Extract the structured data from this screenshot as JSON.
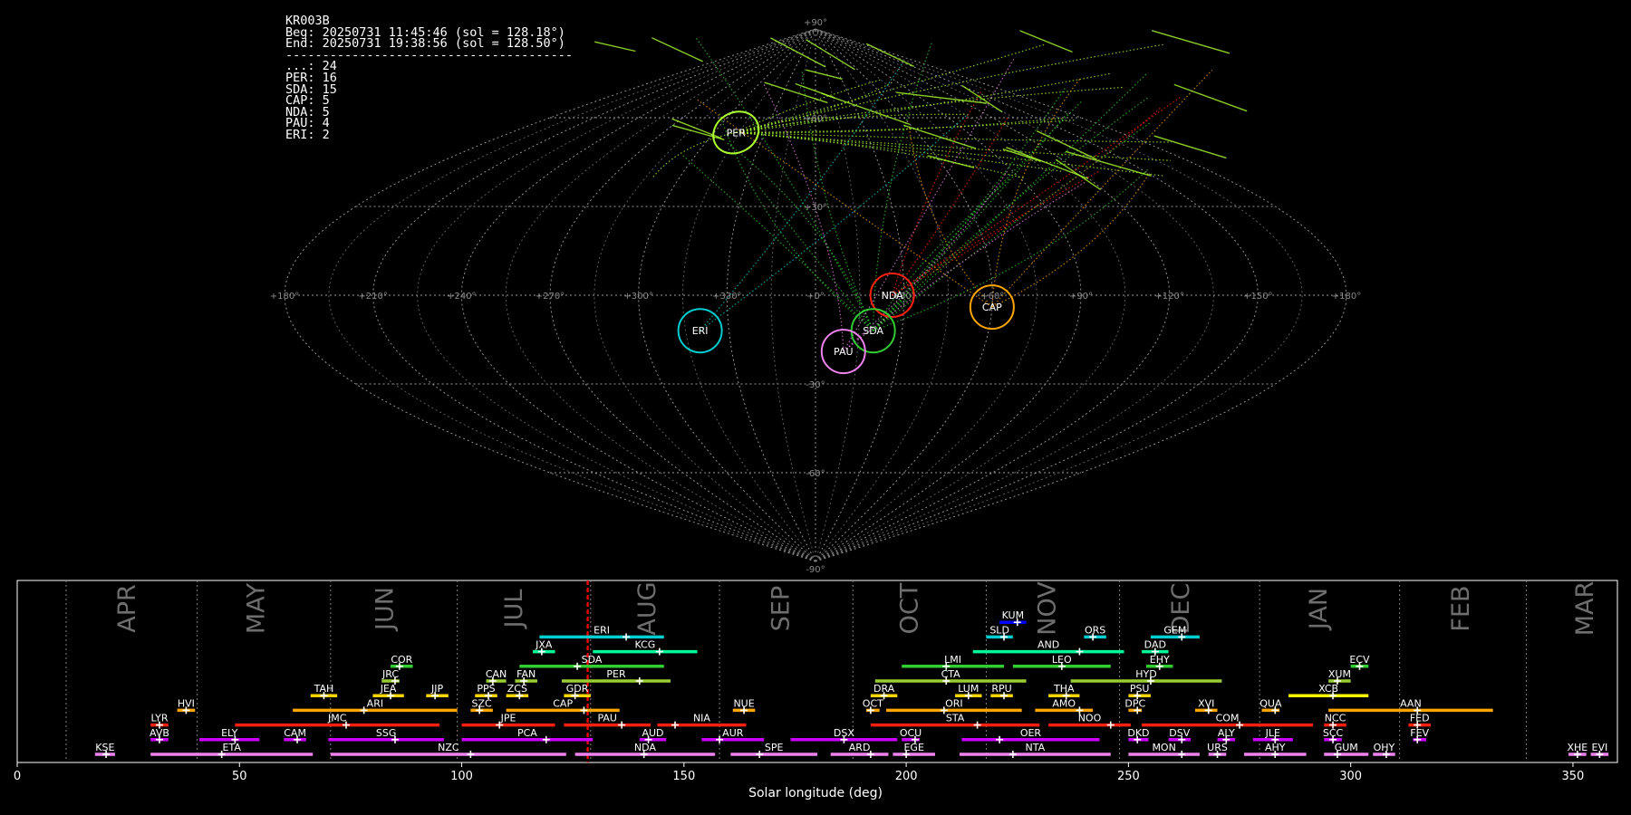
{
  "info": {
    "lines": [
      "KR003B",
      "Beg: 20250731 11:45:46 (sol = 128.18°)",
      "End: 20250731 19:38:56 (sol = 128.50°)",
      "---------------------------------------",
      "...: 24",
      "PER: 16",
      "SDA: 15",
      "CAP: 5",
      "NDA: 5",
      "PAU: 4",
      "ERI: 2"
    ]
  },
  "sky_map": {
    "lon_labels": [
      "+180°",
      "+150°",
      "+120°",
      "+90°",
      "+60°",
      "+30°",
      "+0°",
      "+330°",
      "+300°",
      "+270°",
      "+240°",
      "+210°",
      "+180°"
    ],
    "lat_labels": [
      "+90°",
      "+60°",
      "+30°",
      "-30°",
      "-60°",
      "-90°"
    ],
    "radiants": [
      {
        "code": "PER",
        "lon": 47,
        "lat": 55,
        "color": "#adff2f"
      },
      {
        "code": "NDA",
        "lon": 334,
        "lat": 0,
        "color": "#ff2010"
      },
      {
        "code": "CAP",
        "lon": 300,
        "lat": -4,
        "color": "#ffa500"
      },
      {
        "code": "SDA",
        "lon": 340,
        "lat": -12,
        "color": "#32cd32"
      },
      {
        "code": "PAU",
        "lon": 350,
        "lat": -19,
        "color": "#ee82ee"
      },
      {
        "code": "ERI",
        "lon": 40,
        "lat": -12,
        "color": "#00ced1"
      }
    ]
  },
  "chart_data": {
    "type": "timeline",
    "xlabel": "Solar longitude (deg)",
    "xlim": [
      0,
      360
    ],
    "xticks": [
      0,
      50,
      100,
      150,
      200,
      250,
      300,
      350
    ],
    "current_sol_range": [
      128.18,
      128.5
    ],
    "months": [
      {
        "name": "APR",
        "start": 11,
        "label_at": 25
      },
      {
        "name": "MAY",
        "start": 40.5,
        "label_at": 54
      },
      {
        "name": "JUN",
        "start": 70.5,
        "label_at": 83
      },
      {
        "name": "JUL",
        "start": 99,
        "label_at": 112
      },
      {
        "name": "AUG",
        "start": 129,
        "label_at": 142
      },
      {
        "name": "SEP",
        "start": 158,
        "label_at": 172
      },
      {
        "name": "OCT",
        "start": 188,
        "label_at": 201
      },
      {
        "name": "NOV",
        "start": 218,
        "label_at": 232
      },
      {
        "name": "DEC",
        "start": 248,
        "label_at": 262
      },
      {
        "name": "JAN",
        "start": 279.5,
        "label_at": 293
      },
      {
        "name": "FEB",
        "start": 311,
        "label_at": 325
      },
      {
        "name": "MAR",
        "start": 339.5,
        "label_at": 353
      }
    ],
    "showers": [
      {
        "code": "KUM",
        "start": 221,
        "end": 227,
        "peak": 225,
        "row": 10,
        "color": "#0000ff"
      },
      {
        "code": "ERI",
        "start": 117.5,
        "end": 145.5,
        "peak": 137,
        "row": 9,
        "color": "#00ced1"
      },
      {
        "code": "SLD",
        "start": 218,
        "end": 224,
        "peak": 222,
        "row": 9,
        "color": "#00ced1"
      },
      {
        "code": "ORS",
        "start": 240,
        "end": 245,
        "peak": 242,
        "row": 9,
        "color": "#00ced1"
      },
      {
        "code": "GEM",
        "start": 255,
        "end": 266,
        "peak": 262,
        "row": 9,
        "color": "#00ced1"
      },
      {
        "code": "JXA",
        "start": 116,
        "end": 121,
        "peak": 118,
        "row": 8,
        "color": "#00fa9a"
      },
      {
        "code": "KCG",
        "start": 129.5,
        "end": 153,
        "peak": 144.5,
        "row": 8,
        "color": "#00fa9a"
      },
      {
        "code": "AND",
        "start": 215,
        "end": 249,
        "peak": 239,
        "row": 8,
        "color": "#00fa9a"
      },
      {
        "code": "DAD",
        "start": 253,
        "end": 259,
        "peak": 256,
        "row": 8,
        "color": "#00fa9a"
      },
      {
        "code": "COR",
        "start": 84,
        "end": 89,
        "peak": 86,
        "row": 7,
        "color": "#32cd32"
      },
      {
        "code": "SDA",
        "start": 113,
        "end": 145.5,
        "peak": 126,
        "row": 7,
        "color": "#32cd32"
      },
      {
        "code": "LMI",
        "start": 199,
        "end": 222,
        "peak": 209,
        "row": 7,
        "color": "#32cd32"
      },
      {
        "code": "LEO",
        "start": 224,
        "end": 246,
        "peak": 235,
        "row": 7,
        "color": "#32cd32"
      },
      {
        "code": "EHY",
        "start": 254,
        "end": 260,
        "peak": 257,
        "row": 7,
        "color": "#32cd32"
      },
      {
        "code": "ECV",
        "start": 300,
        "end": 304,
        "peak": 302,
        "row": 7,
        "color": "#32cd32"
      },
      {
        "code": "JRC",
        "start": 82,
        "end": 86,
        "peak": 85,
        "row": 6,
        "color": "#9acd32"
      },
      {
        "code": "CAN",
        "start": 105.5,
        "end": 110,
        "peak": 107,
        "row": 6,
        "color": "#9acd32"
      },
      {
        "code": "FAN",
        "start": 112,
        "end": 117,
        "peak": 114,
        "row": 6,
        "color": "#9acd32"
      },
      {
        "code": "PER",
        "start": 122.5,
        "end": 147,
        "peak": 140,
        "row": 6,
        "color": "#9acd32"
      },
      {
        "code": "CTA",
        "start": 193,
        "end": 227,
        "peak": 209,
        "row": 6,
        "color": "#9acd32"
      },
      {
        "code": "HYD",
        "start": 237,
        "end": 271,
        "peak": 255,
        "row": 6,
        "color": "#9acd32"
      },
      {
        "code": "XUM",
        "start": 295,
        "end": 300,
        "peak": 297,
        "row": 6,
        "color": "#9acd32"
      },
      {
        "code": "TAH",
        "start": 66,
        "end": 72,
        "peak": 69,
        "row": 5,
        "color": "#ffd700"
      },
      {
        "code": "JEA",
        "start": 80,
        "end": 87,
        "peak": 84,
        "row": 5,
        "color": "#ffd700"
      },
      {
        "code": "JIP",
        "start": 92,
        "end": 97,
        "peak": 94,
        "row": 5,
        "color": "#ffd700"
      },
      {
        "code": "PPS",
        "start": 103,
        "end": 108,
        "peak": 106,
        "row": 5,
        "color": "#ffd700"
      },
      {
        "code": "ZCS",
        "start": 110,
        "end": 115,
        "peak": 113,
        "row": 5,
        "color": "#ffd700"
      },
      {
        "code": "GDR",
        "start": 123,
        "end": 129,
        "peak": 125.5,
        "row": 5,
        "color": "#ffd700"
      },
      {
        "code": "DRA",
        "start": 192,
        "end": 198,
        "peak": 195,
        "row": 5,
        "color": "#ffd700"
      },
      {
        "code": "LUM",
        "start": 211,
        "end": 217,
        "peak": 214,
        "row": 5,
        "color": "#ffd700"
      },
      {
        "code": "RPU",
        "start": 219,
        "end": 224,
        "peak": 222,
        "row": 5,
        "color": "#ffd700"
      },
      {
        "code": "THA",
        "start": 232,
        "end": 239,
        "peak": 236,
        "row": 5,
        "color": "#ffd700"
      },
      {
        "code": "PSU",
        "start": 250,
        "end": 255,
        "peak": 252,
        "row": 5,
        "color": "#ffd700"
      },
      {
        "code": "XCB",
        "start": 286,
        "end": 304,
        "peak": 296,
        "row": 5,
        "color": "#ffff00"
      },
      {
        "code": "HVI",
        "start": 36,
        "end": 40,
        "peak": 38,
        "row": 4,
        "color": "#ffa500"
      },
      {
        "code": "ARI",
        "start": 62,
        "end": 99,
        "peak": 78,
        "row": 4,
        "color": "#ffa500"
      },
      {
        "code": "SZC",
        "start": 102,
        "end": 107,
        "peak": 104,
        "row": 4,
        "color": "#ffa500"
      },
      {
        "code": "CAP",
        "start": 110,
        "end": 135.5,
        "peak": 127.5,
        "row": 4,
        "color": "#ffa500"
      },
      {
        "code": "NUE",
        "start": 161,
        "end": 166,
        "peak": 163.5,
        "row": 4,
        "color": "#ffa500"
      },
      {
        "code": "OCT",
        "start": 191,
        "end": 194,
        "peak": 192,
        "row": 4,
        "color": "#ffa500"
      },
      {
        "code": "ORI",
        "start": 195.5,
        "end": 226,
        "peak": 208.5,
        "row": 4,
        "color": "#ffa500"
      },
      {
        "code": "AMO",
        "start": 229,
        "end": 242,
        "peak": 239,
        "row": 4,
        "color": "#ffa500"
      },
      {
        "code": "DPC",
        "start": 250,
        "end": 253,
        "peak": 252,
        "row": 4,
        "color": "#ffa500"
      },
      {
        "code": "XVI",
        "start": 265,
        "end": 270,
        "peak": 268,
        "row": 4,
        "color": "#ffa500"
      },
      {
        "code": "QUA",
        "start": 280,
        "end": 284,
        "peak": 283,
        "row": 4,
        "color": "#ffa500"
      },
      {
        "code": "AAN",
        "start": 295,
        "end": 332,
        "peak": 315,
        "row": 4,
        "color": "#ffa500"
      },
      {
        "code": "LYR",
        "start": 30,
        "end": 34,
        "peak": 32,
        "row": 3,
        "color": "#ff2010"
      },
      {
        "code": "JMC",
        "start": 49,
        "end": 95,
        "peak": 74,
        "row": 3,
        "color": "#ff2010"
      },
      {
        "code": "JPE",
        "start": 100,
        "end": 121,
        "peak": 108.5,
        "row": 3,
        "color": "#ff2010"
      },
      {
        "code": "PAU",
        "start": 123,
        "end": 142.5,
        "peak": 136,
        "row": 3,
        "color": "#ff2010"
      },
      {
        "code": "NIA",
        "start": 144,
        "end": 164,
        "peak": 148,
        "row": 3,
        "color": "#ff2010"
      },
      {
        "code": "STA",
        "start": 192,
        "end": 230,
        "peak": 216,
        "row": 3,
        "color": "#ff2010"
      },
      {
        "code": "NOO",
        "start": 232,
        "end": 250.5,
        "peak": 246,
        "row": 3,
        "color": "#ff2010"
      },
      {
        "code": "COM",
        "start": 253,
        "end": 291.5,
        "peak": 275,
        "row": 3,
        "color": "#ff2010"
      },
      {
        "code": "NCC",
        "start": 294,
        "end": 299,
        "peak": 296,
        "row": 3,
        "color": "#ff2010"
      },
      {
        "code": "FED",
        "start": 313,
        "end": 318,
        "peak": 315,
        "row": 3,
        "color": "#ff2010"
      },
      {
        "code": "AVB",
        "start": 30,
        "end": 34,
        "peak": 32,
        "row": 2,
        "color": "#cc00ff"
      },
      {
        "code": "ELY",
        "start": 41,
        "end": 54.5,
        "peak": 49,
        "row": 2,
        "color": "#cc00ff"
      },
      {
        "code": "CAM",
        "start": 60,
        "end": 65,
        "peak": 63,
        "row": 2,
        "color": "#cc00ff"
      },
      {
        "code": "SSG",
        "start": 70,
        "end": 96,
        "peak": 85,
        "row": 2,
        "color": "#cc00ff"
      },
      {
        "code": "PCA",
        "start": 100,
        "end": 129.5,
        "peak": 119,
        "row": 2,
        "color": "#cc00ff"
      },
      {
        "code": "AUD",
        "start": 140,
        "end": 146,
        "peak": 142,
        "row": 2,
        "color": "#cc00ff"
      },
      {
        "code": "AUR",
        "start": 154,
        "end": 168,
        "peak": 158,
        "row": 2,
        "color": "#cc00ff"
      },
      {
        "code": "DSX",
        "start": 174,
        "end": 198,
        "peak": 186,
        "row": 2,
        "color": "#cc00ff"
      },
      {
        "code": "OCU",
        "start": 199,
        "end": 203,
        "peak": 202,
        "row": 2,
        "color": "#cc00ff"
      },
      {
        "code": "OER",
        "start": 212.5,
        "end": 243.5,
        "peak": 221,
        "row": 2,
        "color": "#cc00ff"
      },
      {
        "code": "DKD",
        "start": 250,
        "end": 254.5,
        "peak": 252,
        "row": 2,
        "color": "#cc00ff"
      },
      {
        "code": "DSV",
        "start": 259,
        "end": 264,
        "peak": 262,
        "row": 2,
        "color": "#cc00ff"
      },
      {
        "code": "ALY",
        "start": 270,
        "end": 274,
        "peak": 272,
        "row": 2,
        "color": "#cc00ff"
      },
      {
        "code": "JLE",
        "start": 278,
        "end": 287,
        "peak": 283,
        "row": 2,
        "color": "#cc00ff"
      },
      {
        "code": "SCC",
        "start": 294,
        "end": 298,
        "peak": 296,
        "row": 2,
        "color": "#cc00ff"
      },
      {
        "code": "FEV",
        "start": 314,
        "end": 317,
        "peak": 315,
        "row": 2,
        "color": "#cc00ff"
      },
      {
        "code": "KSE",
        "start": 17.5,
        "end": 22,
        "peak": 20,
        "row": 1,
        "color": "#ee82ee"
      },
      {
        "code": "ETA",
        "start": 30,
        "end": 66.5,
        "peak": 46,
        "row": 1,
        "color": "#ee82ee"
      },
      {
        "code": "NZC",
        "start": 70.5,
        "end": 123.5,
        "peak": 102,
        "row": 1,
        "color": "#ee82ee"
      },
      {
        "code": "NDA",
        "start": 125.5,
        "end": 157,
        "peak": 141,
        "row": 1,
        "color": "#ee82ee"
      },
      {
        "code": "SPE",
        "start": 160.5,
        "end": 180,
        "peak": 167,
        "row": 1,
        "color": "#ee82ee"
      },
      {
        "code": "ARD",
        "start": 183,
        "end": 196,
        "peak": 192,
        "row": 1,
        "color": "#ee82ee"
      },
      {
        "code": "EGE",
        "start": 197,
        "end": 206.5,
        "peak": 200,
        "row": 1,
        "color": "#ee82ee"
      },
      {
        "code": "NTA",
        "start": 212,
        "end": 246,
        "peak": 224,
        "row": 1,
        "color": "#ee82ee"
      },
      {
        "code": "MON",
        "start": 250,
        "end": 266,
        "peak": 262,
        "row": 1,
        "color": "#ee82ee"
      },
      {
        "code": "URS",
        "start": 268,
        "end": 272,
        "peak": 270,
        "row": 1,
        "color": "#ee82ee"
      },
      {
        "code": "AHY",
        "start": 276,
        "end": 290,
        "peak": 283,
        "row": 1,
        "color": "#ee82ee"
      },
      {
        "code": "GUM",
        "start": 294,
        "end": 304,
        "peak": 297,
        "row": 1,
        "color": "#ee82ee"
      },
      {
        "code": "OHY",
        "start": 305,
        "end": 310,
        "peak": 308,
        "row": 1,
        "color": "#ee82ee"
      },
      {
        "code": "XHE",
        "start": 349,
        "end": 353,
        "peak": 351,
        "row": 1,
        "color": "#ee82ee"
      },
      {
        "code": "EVI",
        "start": 354,
        "end": 358,
        "peak": 356,
        "row": 1,
        "color": "#ee82ee"
      }
    ]
  }
}
